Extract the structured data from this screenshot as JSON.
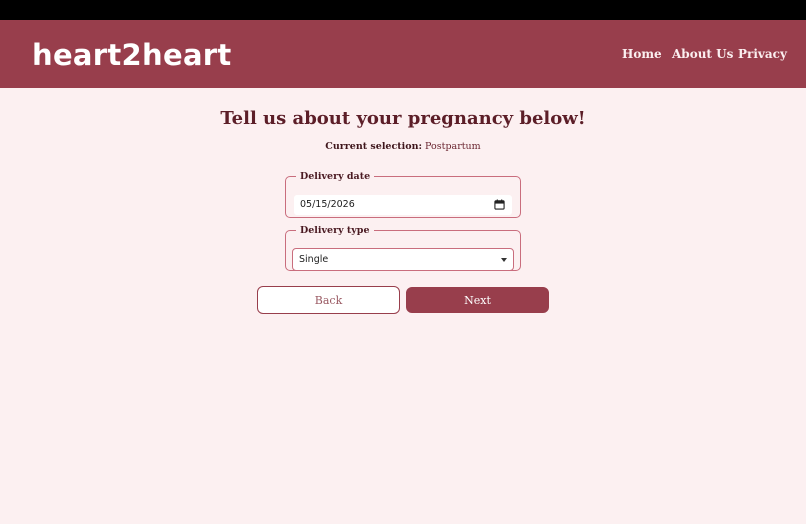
{
  "app": {
    "logo": "heart2heart"
  },
  "nav": {
    "home": "Home",
    "about": "About Us",
    "privacy": "Privacy"
  },
  "form": {
    "title": "Tell us about your pregnancy below!",
    "selection_label": "Current selection:",
    "selection_value": "Postpartum",
    "delivery_date": {
      "legend": "Delivery date",
      "value": "05/15/2026"
    },
    "delivery_type": {
      "legend": "Delivery type",
      "value": "Single"
    },
    "back_label": "Back",
    "next_label": "Next"
  },
  "colors": {
    "brand": "#983e4c",
    "background": "#fcf0f1",
    "accent_border": "#c96d7d"
  },
  "icons": {
    "date_picker": "calendar-icon",
    "select": "chevron-down-icon"
  }
}
